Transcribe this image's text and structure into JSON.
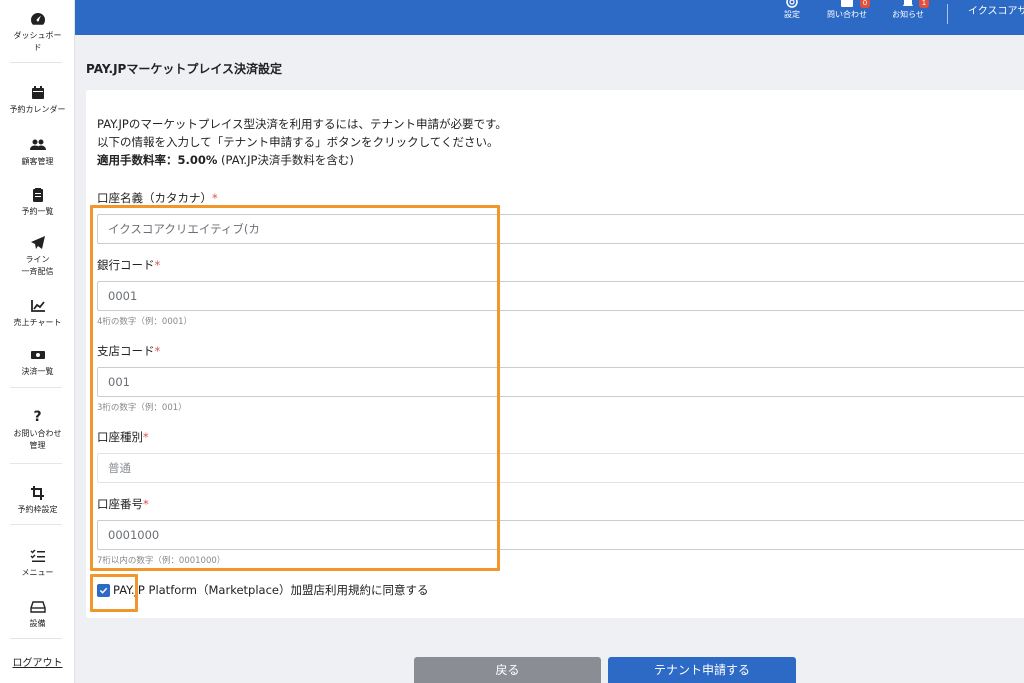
{
  "sidebar": {
    "items": [
      {
        "name": "dashboard",
        "label": "ダッシュボード"
      },
      {
        "name": "calendar",
        "label": "予約カレンダー"
      },
      {
        "name": "customers",
        "label": "顧客管理"
      },
      {
        "name": "reservations",
        "label": "予約一覧"
      },
      {
        "name": "line",
        "label1": "ライン",
        "label2": "一斉配信"
      },
      {
        "name": "sales",
        "label": "売上チャート"
      },
      {
        "name": "payments",
        "label": "決済一覧"
      },
      {
        "name": "inquiries",
        "label1": "お問い合わせ",
        "label2": "管理"
      },
      {
        "name": "slots",
        "label": "予約枠設定"
      },
      {
        "name": "menu",
        "label": "メニュー"
      },
      {
        "name": "equipment",
        "label": "設備"
      }
    ],
    "logout": "ログアウト"
  },
  "header": {
    "settings": "設定",
    "inquiries": "問い合わせ",
    "inquiries_badge": "0",
    "notices": "お知らせ",
    "notices_badge": "1",
    "user": "イクスコアサ"
  },
  "page": {
    "title": "PAY.JPマーケットプレイス決済設定",
    "intro_line1": "PAY.JPのマーケットプレイス型決済を利用するには、テナント申請が必要です。",
    "intro_line2": "以下の情報を入力して「テナント申請する」ボタンをクリックしてください。",
    "fee_label": "適用手数料率：5.00%",
    "fee_note": " (PAY.JP決済手数料を含む)"
  },
  "form": {
    "account_name_label": "口座名義（カタカナ）",
    "account_name_value": "イクスコアクリエイティブ(カ",
    "bank_code_label": "銀行コード",
    "bank_code_value": "0001",
    "bank_code_hint": "4桁の数字（例：0001）",
    "branch_code_label": "支店コード",
    "branch_code_value": "001",
    "branch_code_hint": "3桁の数字（例：001）",
    "account_type_label": "口座種別",
    "account_type_value": "普通",
    "account_number_label": "口座番号",
    "account_number_value": "0001000",
    "account_number_hint": "7桁以内の数字（例：0001000）",
    "required_mark": "*",
    "agree_text": "PAY.JP Platform（Marketplace）加盟店利用規約に同意する",
    "agree_checked": true
  },
  "buttons": {
    "back": "戻る",
    "apply": "テナント申請する"
  },
  "colors": {
    "header": "#2d6ac6",
    "highlight": "#f0962a",
    "required": "#d9534f"
  }
}
